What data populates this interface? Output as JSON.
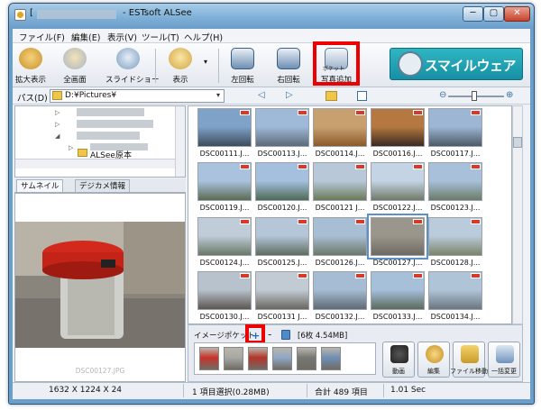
{
  "window": {
    "title_bracket": "[",
    "title": "- ESTsoft ALSee"
  },
  "caption_buttons": {
    "minimize": "─",
    "maximize": "▢",
    "close": "✕"
  },
  "menu": [
    "ファイル(F)",
    "編集(E)",
    "表示(V)",
    "ツール(T)",
    "ヘルプ(H)"
  ],
  "toolbar": {
    "zoom": "拡大表示",
    "fullscreen": "全画面",
    "slideshow": "スライドショー",
    "view": "表示",
    "rotate_left": "左回転",
    "rotate_right": "右回転",
    "pocket_add": "写真追加",
    "pocket_add_sub": "ポケット",
    "dropdown": "▾"
  },
  "banner": {
    "text": "スマイルウェア"
  },
  "address": {
    "label": "パス(D)",
    "path": "D:¥Pictures¥",
    "dropdown": "▾"
  },
  "nav": {
    "back": "◁",
    "forward": "▷",
    "zoom_minus": "⊖",
    "zoom_plus": "⊕"
  },
  "tree": {
    "selected_item": "ALSee原本"
  },
  "preview": {
    "tab_thumbnail": "サムネイル",
    "tab_digicam": "デジカメ情報",
    "caption": "DSC00127.JPG"
  },
  "thumbnails": [
    "DSC00111.J...",
    "DSC00113.J...",
    "DSC00114.J...",
    "DSC00116.J...",
    "DSC00117.J...",
    "DSC00119.J...",
    "DSC00120.J...",
    "DSC00121 J...",
    "DSC00122.J...",
    "DSC00123.J...",
    "DSC00124.J...",
    "DSC00125.J...",
    "DSC00126.J...",
    "DSC00127.J...",
    "DSC00128.J...",
    "DSC00130.J...",
    "DSC00131 J...",
    "DSC00132.J...",
    "DSC00133.J...",
    "DSC00134.J..."
  ],
  "selected_thumbnail_index": 13,
  "pocket": {
    "label": "イメージポケット",
    "add": "+",
    "minus": "-",
    "count": "[6枚  4.54MB]",
    "actions": [
      "動画",
      "編集",
      "ファイル移動",
      "一括変更"
    ]
  },
  "status": {
    "dimensions": "1632 X 1224 X 24",
    "selection": "1 項目選択(0.28MB)",
    "total": "合計 489 項目",
    "time": "1.01 Sec"
  },
  "colors": {
    "highlight": "#ee0000",
    "selection": "#5c90c8",
    "banner": "#1ea3b5"
  }
}
